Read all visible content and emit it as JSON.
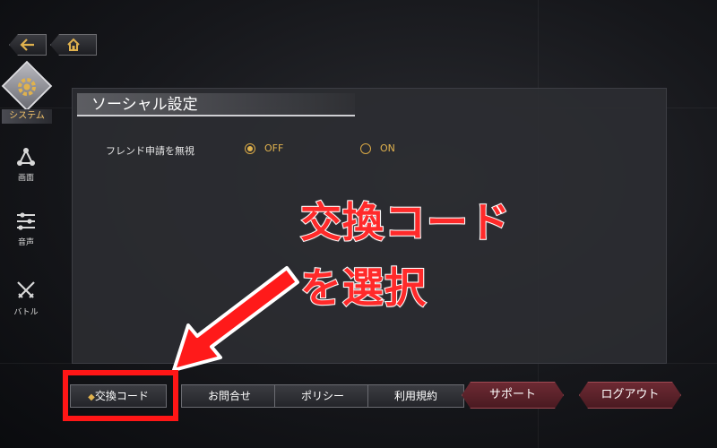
{
  "nav": {
    "back_icon": "back-arrow-icon",
    "home_icon": "home-icon"
  },
  "sidebar": {
    "active": {
      "label": "システム",
      "icon": "gear-icon"
    },
    "items": [
      {
        "label": "画面",
        "icon": "screen-icon"
      },
      {
        "label": "音声",
        "icon": "sliders-icon"
      },
      {
        "label": "バトル",
        "icon": "crossed-swords-icon"
      }
    ]
  },
  "panel": {
    "title": "ソーシャル設定",
    "setting": {
      "label": "フレンド申請を無視",
      "options": [
        {
          "label": "OFF",
          "selected": true
        },
        {
          "label": "ON",
          "selected": false
        }
      ]
    }
  },
  "annotation": {
    "line1": "交換コード",
    "line2": "を選択",
    "color": "#ff2a2a"
  },
  "footer": {
    "buttons": [
      {
        "label": "交換コード"
      },
      {
        "label": "お問合せ"
      },
      {
        "label": "ポリシー"
      },
      {
        "label": "利用規約"
      }
    ],
    "support_label": "サポート",
    "logout_label": "ログアウト"
  },
  "colors": {
    "accent_gold": "#e0b24e",
    "highlight_red": "#ff1616",
    "button_red": "#6d2a33"
  }
}
